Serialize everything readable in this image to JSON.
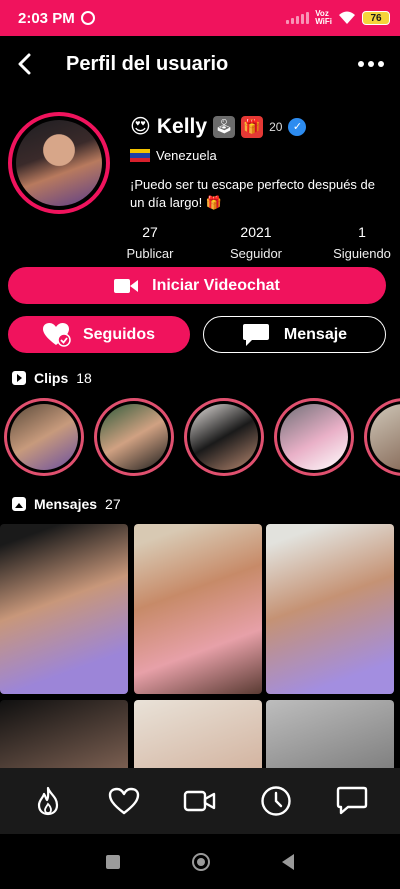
{
  "status_bar": {
    "time": "2:03 PM",
    "network": "Voz WiFi",
    "battery": "76"
  },
  "header": {
    "title": "Perfil del usuario"
  },
  "profile": {
    "emoji": "😍",
    "name": "Kelly",
    "level": "20",
    "country": "Venezuela",
    "bio": "¡Puedo ser tu escape perfecto después de un día largo! 🎁",
    "stats": [
      {
        "value": "27",
        "label": "Publicar"
      },
      {
        "value": "2021",
        "label": "Seguidor"
      },
      {
        "value": "1",
        "label": "Siguiendo"
      }
    ]
  },
  "actions": {
    "videochat_label": "Iniciar Videochat",
    "follow_label": "Seguidos",
    "message_label": "Mensaje"
  },
  "clips": {
    "label": "Clips",
    "count": "18"
  },
  "posts": {
    "label": "Mensajes",
    "count": "27"
  },
  "colors": {
    "accent": "#f0135d",
    "background": "#000000",
    "nav_bg": "#1a1a1a"
  },
  "bottom_nav": [
    "flame-icon",
    "heart-icon",
    "video-camera-icon",
    "clock-icon",
    "chat-bubble-icon"
  ]
}
